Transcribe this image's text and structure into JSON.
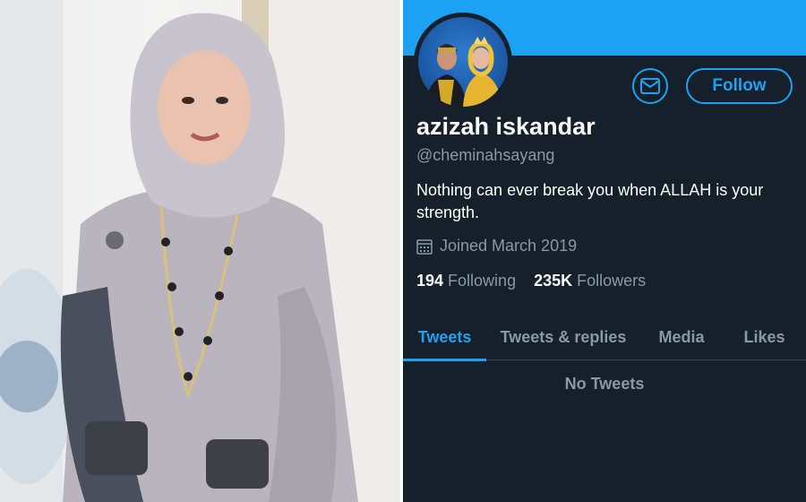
{
  "profile": {
    "name": "azizah iskandar",
    "handle": "@cheminahsayang",
    "bio": "Nothing can ever break you when ALLAH is your strength.",
    "joined": "Joined March 2019",
    "following_count": "194",
    "following_label": "Following",
    "followers_count": "235K",
    "followers_label": "Followers"
  },
  "actions": {
    "follow_label": "Follow"
  },
  "tabs": [
    {
      "label": "Tweets",
      "active": true
    },
    {
      "label": "Tweets & replies",
      "active": false
    },
    {
      "label": "Media",
      "active": false
    },
    {
      "label": "Likes",
      "active": false
    }
  ],
  "timeline": {
    "empty_message": "No Tweets"
  },
  "colors": {
    "accent": "#1da1f2",
    "background": "#15202b",
    "muted_text": "#8899a6"
  }
}
